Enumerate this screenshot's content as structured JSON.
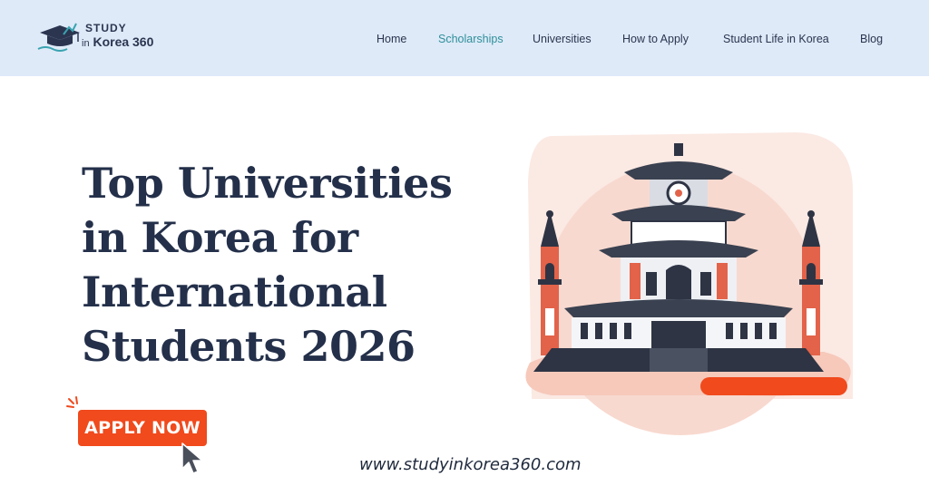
{
  "header": {
    "logo": {
      "line1": "STUDY",
      "line2_prefix": "in",
      "line2_main": "Korea 360",
      "icon": "graduation-cap-icon"
    },
    "nav": [
      {
        "label": "Home",
        "active": false
      },
      {
        "label": "Scholarships",
        "active": true
      },
      {
        "label": "Universities",
        "active": false
      },
      {
        "label": "How to Apply",
        "active": false
      },
      {
        "label": "Student Life in Korea",
        "active": false
      },
      {
        "label": "Blog",
        "active": false
      }
    ]
  },
  "hero": {
    "title_lines": [
      "Top Universities",
      "in Korea for",
      "International",
      "Students 2026"
    ],
    "cta_label": "APPLY NOW",
    "website": "www.studyinkorea360.com",
    "illustration": "korean-university-building"
  },
  "colors": {
    "header_bg": "#deeaf8",
    "accent": "#f04a1d",
    "nav_active": "#2f8f9a",
    "text_dark": "#24304a"
  }
}
